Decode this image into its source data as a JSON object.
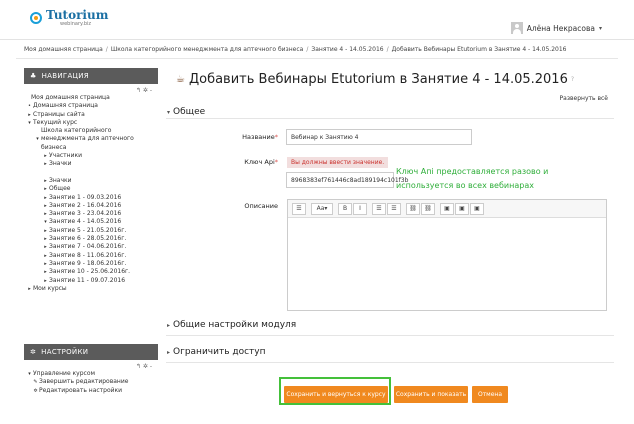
{
  "header": {
    "logo_name": "Tutorium",
    "logo_sub": "webinary.biz",
    "user_name": "Алёна Некрасова",
    "caret": "▾"
  },
  "breadcrumb": [
    "Моя домашняя страница",
    "Школа категорийного менеджмента для аптечного бизнеса",
    "Занятие 4 - 14.05.2016",
    "Добавить Вебинары Etutorium в Занятие 4 - 14.05.2016"
  ],
  "nav_block": {
    "title": "НАВИГАЦИЯ",
    "tools": "↰ ✲ -",
    "items": [
      {
        "label": "Моя домашняя страница",
        "mark": ""
      },
      {
        "label": "Домашняя страница",
        "mark": "•"
      },
      {
        "label": "Страницы сайта",
        "mark": "▸"
      },
      {
        "label": "Текущий курс",
        "mark": "▾"
      },
      {
        "label": "Школа категорийного",
        "mark": ""
      },
      {
        "label": "менеджмента для аптечного",
        "mark": "▾"
      },
      {
        "label": "бизнеса",
        "mark": ""
      },
      {
        "label": "Участники",
        "mark": "▸"
      },
      {
        "label": "Значки",
        "mark": "▸"
      },
      {
        "label": "",
        "mark": ""
      },
      {
        "label": "Значки",
        "mark": "▸"
      },
      {
        "label": "Общее",
        "mark": "▸"
      },
      {
        "label": "Занятие 1 - 09.03.2016",
        "mark": "▸"
      },
      {
        "label": "Занятие 2 - 16.04.2016",
        "mark": "▸"
      },
      {
        "label": "Занятие 3 - 23.04.2016",
        "mark": "▸"
      },
      {
        "label": "Занятие 4 - 14.05.2016",
        "mark": "▾"
      },
      {
        "label": "Занятие 5 - 21.05.2016г.",
        "mark": "▸"
      },
      {
        "label": "Занятие 6 - 28.05.2016г.",
        "mark": "▸"
      },
      {
        "label": "Занятие 7 - 04.06.2016г.",
        "mark": "▸"
      },
      {
        "label": "Занятие 8 - 11.06.2016г.",
        "mark": "▸"
      },
      {
        "label": "Занятие 9 - 18.06.2016г.",
        "mark": "▸"
      },
      {
        "label": "Занятие 10 - 25.06.2016г.",
        "mark": "▸"
      },
      {
        "label": "Занятие 11 - 09.07.2016",
        "mark": "▸"
      },
      {
        "label": "Мои курсы",
        "mark": "▸"
      }
    ]
  },
  "settings_block": {
    "title": "НАСТРОЙКИ",
    "tools": "↰ ✲ -",
    "items": [
      {
        "label": "Управление курсом",
        "mark": "▾"
      },
      {
        "label": "Завершить редактирование",
        "mark": "✎"
      },
      {
        "label": "Редактировать настройки",
        "mark": "✲"
      }
    ]
  },
  "main": {
    "title": "Добавить Вебинары Etutorium в Занятие 4 - 14.05.2016",
    "title_help": "?",
    "expand_all": "Развернуть всё",
    "section_general": "Общее",
    "section_module": "Общие настройки модуля",
    "section_access": "Ограничить доступ",
    "name_label": "Название",
    "name_value": "Вебинар к Занятию 4",
    "api_label": "Ключ Api",
    "api_error": "Вы должны ввести значение.",
    "api_value": "8968383ef761446c8ad189194c101f3b",
    "desc_label": "Описание",
    "required_mark": "*",
    "note": "Ключ Апі предоставляется разово и используется во всех вебинарах",
    "toolbar": [
      "☰",
      "Aa▾",
      "B",
      "I",
      "☰",
      "☰",
      "⛓",
      "⛓",
      "▣",
      "▣",
      "▣"
    ]
  },
  "buttons": {
    "save_return": "Сохранить и вернуться к курсу",
    "save_show": "Сохранить и показать",
    "cancel": "Отмена"
  },
  "colors": {
    "accent": "#f0891f",
    "highlight": "#44c03a",
    "note": "#2fae3a"
  }
}
